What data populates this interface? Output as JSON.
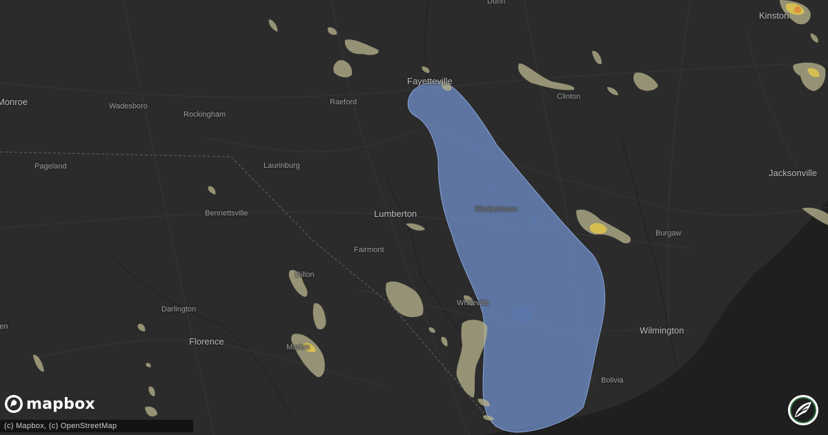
{
  "map": {
    "basemap_color": "#2b2b2b",
    "swath_color": "#6f8fc8",
    "radar_colors": {
      "light": "#b5b08a",
      "medium": "#e2c64a",
      "heavy": "#e0903c"
    }
  },
  "places": [
    {
      "name": "Dunn",
      "size": "normal"
    },
    {
      "name": "Kinston",
      "size": "big"
    },
    {
      "name": "Monroe",
      "size": "normal"
    },
    {
      "name": "Fayetteville",
      "size": "big"
    },
    {
      "name": "Wadesboro",
      "size": "normal"
    },
    {
      "name": "Raeford",
      "size": "normal"
    },
    {
      "name": "Rockingham",
      "size": "normal"
    },
    {
      "name": "Clinton",
      "size": "normal"
    },
    {
      "name": "Laurinburg",
      "size": "normal"
    },
    {
      "name": "Pageland",
      "size": "normal"
    },
    {
      "name": "Jacksonville",
      "size": "big"
    },
    {
      "name": "Lumberton",
      "size": "big"
    },
    {
      "name": "Elizabethtown",
      "size": "small"
    },
    {
      "name": "Bennettsville",
      "size": "normal"
    },
    {
      "name": "Burgaw",
      "size": "normal"
    },
    {
      "name": "Fairmont",
      "size": "normal"
    },
    {
      "name": "Dillon",
      "size": "normal"
    },
    {
      "name": "Whiteville",
      "size": "normal"
    },
    {
      "name": "Darlington",
      "size": "normal"
    },
    {
      "name": "Wilmington",
      "size": "big"
    },
    {
      "name": "Florence",
      "size": "big"
    },
    {
      "name": "Marion",
      "size": "normal"
    },
    {
      "name": "Bolivia",
      "size": "normal"
    },
    {
      "name": "Camden",
      "size": "normal"
    }
  ],
  "branding": {
    "logo_text": "mapbox",
    "attribution": "(c) Mapbox, (c) OpenStreetMap",
    "badge_icon": "storm-leaf-icon"
  }
}
